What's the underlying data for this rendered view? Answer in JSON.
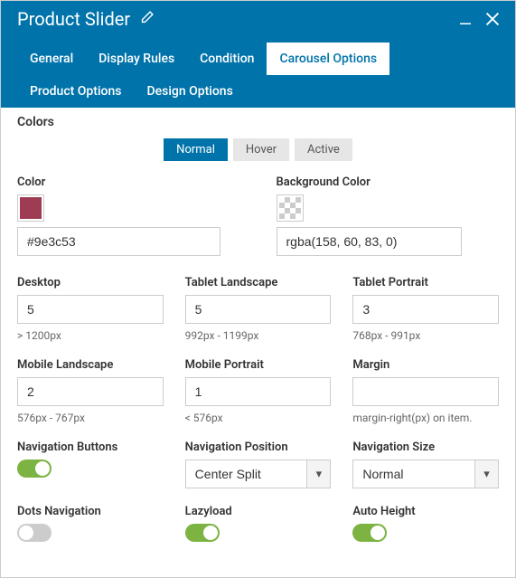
{
  "window": {
    "title": "Product Slider"
  },
  "tabs": {
    "general": "General",
    "display_rules": "Display Rules",
    "condition": "Condition",
    "carousel_options": "Carousel Options",
    "product_options": "Product Options",
    "design_options": "Design Options"
  },
  "colors_section": {
    "title": "Colors",
    "states": {
      "normal": "Normal",
      "hover": "Hover",
      "active": "Active"
    },
    "color": {
      "label": "Color",
      "swatch": "#9e3c53",
      "value": "#9e3c53"
    },
    "bg": {
      "label": "Background Color",
      "value": "rgba(158, 60, 83, 0)"
    }
  },
  "responsive": {
    "desktop": {
      "label": "Desktop",
      "value": "5",
      "hint": "> 1200px"
    },
    "tablet_l": {
      "label": "Tablet Landscape",
      "value": "5",
      "hint": "992px - 1199px"
    },
    "tablet_p": {
      "label": "Tablet Portrait",
      "value": "3",
      "hint": "768px - 991px"
    },
    "mobile_l": {
      "label": "Mobile Landscape",
      "value": "2",
      "hint": "576px - 767px"
    },
    "mobile_p": {
      "label": "Mobile Portrait",
      "value": "1",
      "hint": "< 576px"
    },
    "margin": {
      "label": "Margin",
      "value": "",
      "hint": "margin-right(px) on item."
    }
  },
  "nav": {
    "buttons": {
      "label": "Navigation Buttons",
      "enabled": true
    },
    "position": {
      "label": "Navigation Position",
      "value": "Center Split"
    },
    "size": {
      "label": "Navigation Size",
      "value": "Normal"
    },
    "dots": {
      "label": "Dots Navigation",
      "enabled": false
    },
    "lazyload": {
      "label": "Lazyload",
      "enabled": true
    },
    "autoheight": {
      "label": "Auto Height",
      "enabled": true
    }
  }
}
